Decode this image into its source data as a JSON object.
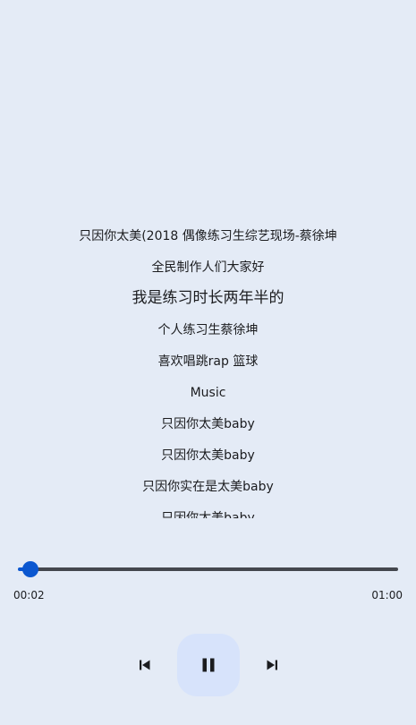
{
  "lyrics": {
    "lines": [
      "只因你太美(2018 偶像练习生综艺现场-蔡徐坤",
      "全民制作人们大家好",
      "我是练习时长两年半的",
      "个人练习生蔡徐坤",
      "喜欢唱跳rap 篮球",
      "Music",
      "只因你太美baby",
      "只因你太美baby",
      "只因你实在是太美baby",
      "只因你太美baby"
    ],
    "current_index": 2
  },
  "player": {
    "elapsed": "00:02",
    "total": "01:00",
    "progress_fraction": 0.033,
    "state": "playing"
  },
  "icons": {
    "previous": "skip-previous-icon",
    "play_pause": "pause-icon",
    "next": "skip-next-icon"
  },
  "colors": {
    "background": "#e4ebf6",
    "accent": "#0b57d0",
    "play_button_bg": "#d7e3fb",
    "track_inactive": "#44474e"
  }
}
